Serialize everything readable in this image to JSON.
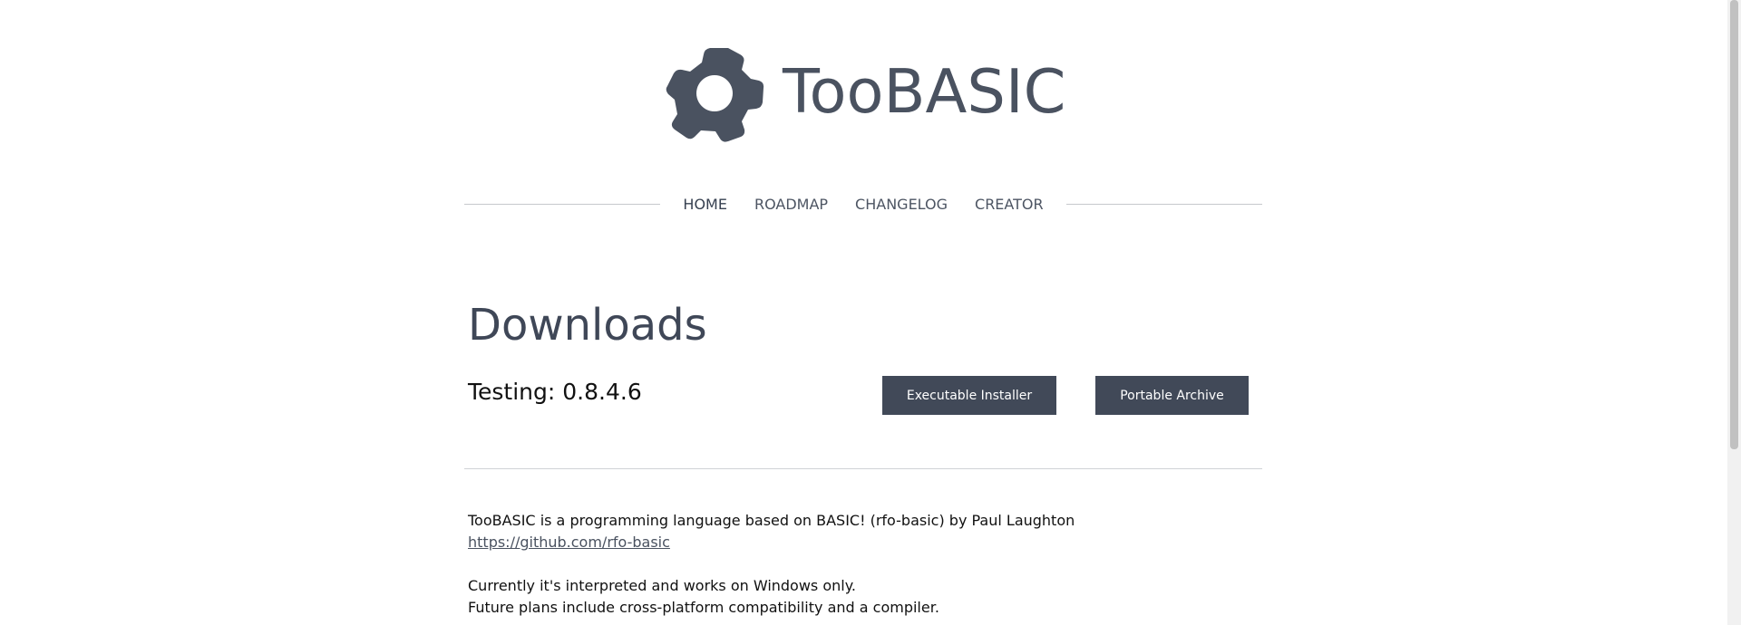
{
  "header": {
    "logo_icon": "gear-icon",
    "logo_text": "TooBASIC"
  },
  "nav": {
    "items": [
      {
        "label": "HOME",
        "active": true
      },
      {
        "label": "ROADMAP",
        "active": false
      },
      {
        "label": "CHANGELOG",
        "active": false
      },
      {
        "label": "CREATOR",
        "active": false
      }
    ]
  },
  "downloads": {
    "title": "Downloads",
    "testing_label": "Testing: 0.8.4.6",
    "buttons": {
      "installer": "Executable Installer",
      "portable": "Portable Archive"
    }
  },
  "description": {
    "line1": "TooBASIC is a programming language based on BASIC! (rfo-basic) by Paul Laughton",
    "link": "https://github.com/rfo-basic",
    "line2": "Currently it's interpreted and works on Windows only.",
    "line3": "Future plans include cross-platform compatibility and a compiler."
  },
  "colors": {
    "primary": "#414958",
    "logo": "#4a5260",
    "text": "#111111",
    "background": "#ffffff"
  }
}
